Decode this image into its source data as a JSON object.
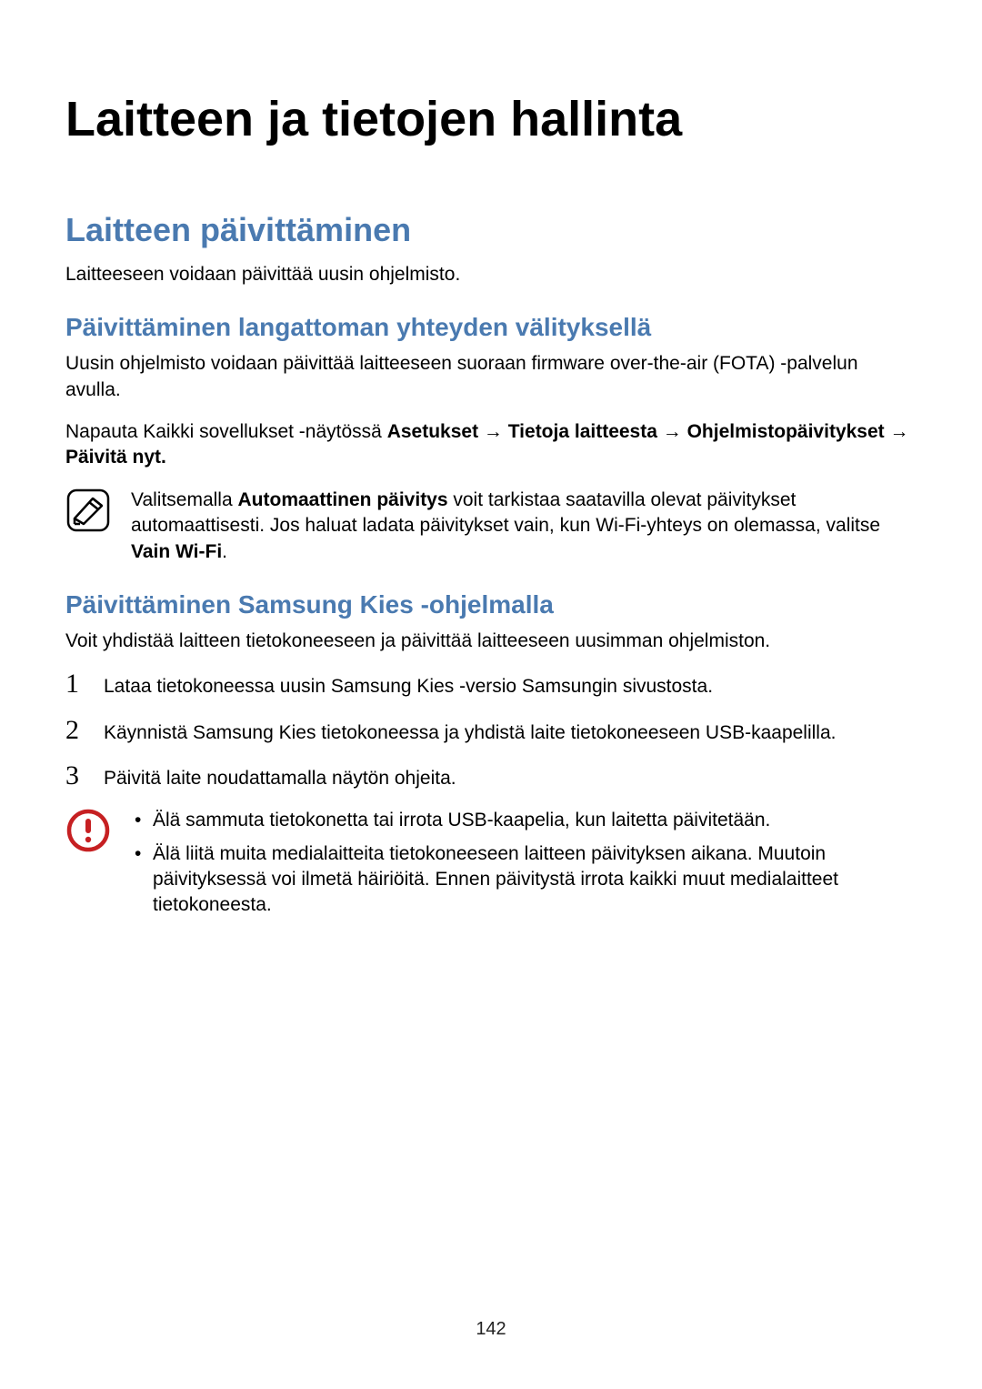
{
  "title": "Laitteen ja tietojen hallinta",
  "section1": {
    "heading": "Laitteen päivittäminen",
    "intro": "Laitteeseen voidaan päivittää uusin ohjelmisto.",
    "sub1": {
      "heading": "Päivittäminen langattoman yhteyden välityksellä",
      "p1": "Uusin ohjelmisto voidaan päivittää laitteeseen suoraan firmware over-the-air (FOTA) -palvelun avulla.",
      "p2a": "Napauta Kaikki sovellukset -näytössä ",
      "p2b": "Asetukset → Tietoja laitteesta → Ohjelmistopäivitykset → Päivitä nyt.",
      "note_a": "Valitsemalla ",
      "note_b": "Automaattinen päivitys",
      "note_c": " voit tarkistaa saatavilla olevat päivitykset automaattisesti. Jos haluat ladata päivitykset vain, kun Wi-Fi-yhteys on olemassa, valitse ",
      "note_d": "Vain Wi-Fi",
      "note_e": "."
    },
    "sub2": {
      "heading": "Päivittäminen Samsung Kies -ohjelmalla",
      "intro": "Voit yhdistää laitteen tietokoneeseen ja päivittää laitteeseen uusimman ohjelmiston.",
      "steps": [
        "Lataa tietokoneessa uusin Samsung Kies -versio Samsungin sivustosta.",
        "Käynnistä Samsung Kies tietokoneessa ja yhdistä laite tietokoneeseen USB-kaapelilla.",
        "Päivitä laite noudattamalla näytön ohjeita."
      ],
      "callout": {
        "items": [
          "Älä sammuta tietokonetta tai irrota USB-kaapelia, kun laitetta päivitetään.",
          "Älä liitä muita medialaitteita tietokoneeseen laitteen päivityksen aikana. Muutoin päivityksessä voi ilmetä häiriöitä. Ennen päivitystä irrota kaikki muut medialaitteet tietokoneesta."
        ]
      }
    }
  },
  "pageNumber": "142"
}
